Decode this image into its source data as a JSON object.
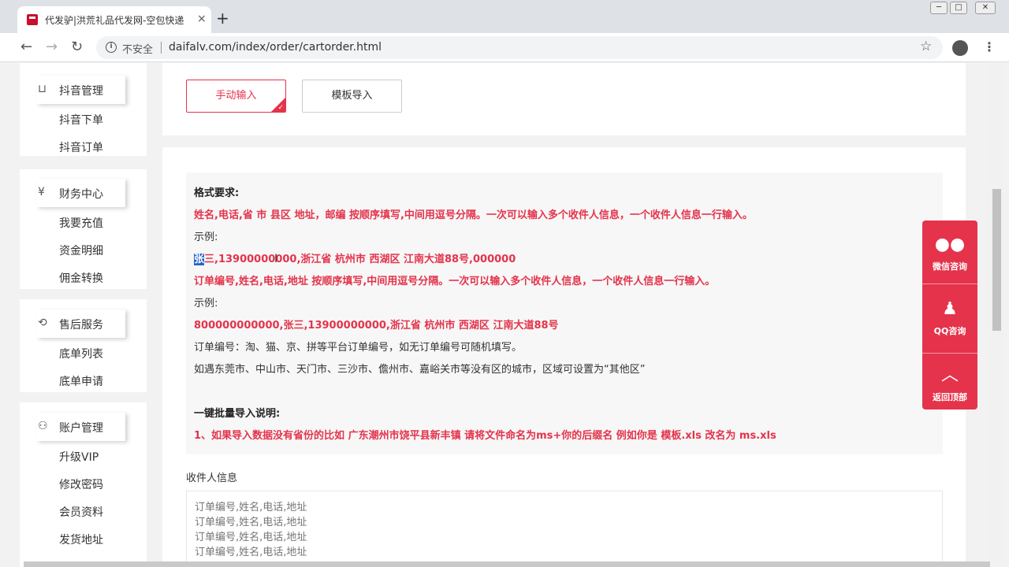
{
  "browser": {
    "tab_title": "代发驴|洪荒礼品代发网-空包快递",
    "tab_close": "×",
    "new_tab": "+",
    "insecure_label": "不安全",
    "url": "daifalv.com/index/order/cartorder.html",
    "window_controls": {
      "minimize": "─",
      "maximize": "□",
      "close": "✕"
    }
  },
  "sidebar": {
    "groups": [
      {
        "title": "抖音管理",
        "icon": "bag-icon",
        "items": [
          "抖音下单",
          "抖音订单"
        ]
      },
      {
        "title": "财务中心",
        "icon": "finance-icon",
        "items": [
          "我要充值",
          "资金明细",
          "佣金转换"
        ]
      },
      {
        "title": "售后服务",
        "icon": "service-icon",
        "items": [
          "底单列表",
          "底单申请"
        ]
      },
      {
        "title": "账户管理",
        "icon": "user-icon",
        "items": [
          "升级VIP",
          "修改密码",
          "会员资料",
          "发货地址"
        ]
      }
    ]
  },
  "input_mode": {
    "manual_label": "手动输入",
    "template_label": "模板导入",
    "active": "manual"
  },
  "format": {
    "title": "格式要求:",
    "rule1": "姓名,电话,省 市 县区 地址，邮编 按顺序填写,中间用逗号分隔。一次可以输入多个收件人信息，一个收件人信息一行输入。",
    "example_label1": "示例:",
    "example1_highlight": "张",
    "example1_rest": "三,13900000000,浙江省 杭州市 西湖区 江南大道88号,000000",
    "rule2": "订单编号,姓名,电话,地址 按顺序填写,中间用逗号分隔。一次可以输入多个收件人信息，一个收件人信息一行输入。",
    "example_label2": "示例:",
    "example2": "800000000000,张三,13900000000,浙江省 杭州市 西湖区 江南大道88号",
    "note1": "订单编号：淘、猫、京、拼等平台订单编号，如无订单编号可随机填写。",
    "note2": "如遇东莞市、中山市、天门市、三沙市、儋州市、嘉峪关市等没有区的城市，区域可设置为“其他区”",
    "bulk_title": "一键批量导入说明:",
    "bulk_rule": "1、如果导入数据没有省份的比如 广东潮州市饶平县新丰镇 请将文件命名为ms+你的后缀名 例如你是 模板.xls 改名为 ms.xls"
  },
  "recipient": {
    "label": "收件人信息",
    "placeholder": "订单编号,姓名,电话,地址\n订单编号,姓名,电话,地址\n订单编号,姓名,电话,地址\n订单编号,姓名,电话,地址"
  },
  "float_bar": {
    "wechat": "微信咨询",
    "qq": "QQ咨询",
    "top": "返回顶部"
  },
  "colors": {
    "accent": "#e4334b",
    "highlight": "#2a63c9"
  }
}
